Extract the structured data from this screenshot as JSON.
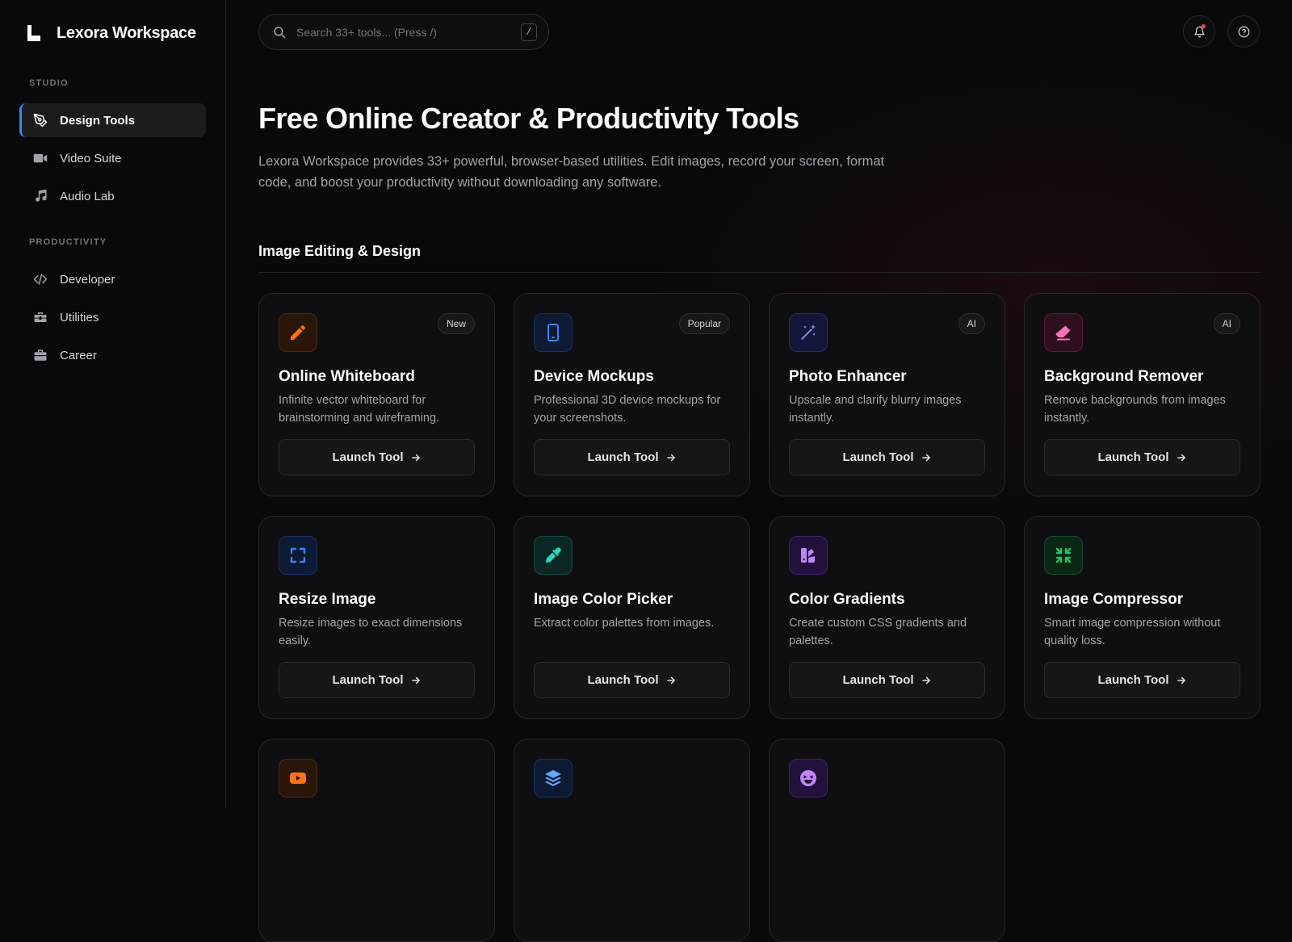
{
  "brand": {
    "name": "Lexora Workspace"
  },
  "sidebar": {
    "sections": [
      {
        "label": "STUDIO",
        "items": [
          {
            "label": "Design Tools",
            "icon": "pen-nib-icon"
          },
          {
            "label": "Video Suite",
            "icon": "video-camera-icon"
          },
          {
            "label": "Audio Lab",
            "icon": "music-note-icon"
          }
        ]
      },
      {
        "label": "PRODUCTIVITY",
        "items": [
          {
            "label": "Developer",
            "icon": "code-icon"
          },
          {
            "label": "Utilities",
            "icon": "toolbox-icon"
          },
          {
            "label": "Career",
            "icon": "briefcase-icon"
          }
        ]
      }
    ],
    "active_item": "Design Tools"
  },
  "search": {
    "placeholder": "Search 33+ tools... (Press /)",
    "shortcut": "/"
  },
  "header": {
    "notification_icon": "bell-icon",
    "help_icon": "question-circle-icon"
  },
  "hero": {
    "title": "Free Online Creator & Productivity Tools",
    "description": "Lexora Workspace provides 33+ powerful, browser-based utilities. Edit images, record your screen, format code, and boost your productivity without downloading any software."
  },
  "section": {
    "title": "Image Editing & Design"
  },
  "colors": {
    "accent": "#3b82f6",
    "notification_dot": "#ef4444"
  },
  "cards": [
    {
      "title": "Online Whiteboard",
      "description": "Infinite vector whiteboard for brainstorming and wireframing.",
      "badge": "New",
      "icon": "pencil-icon",
      "icon_color": "#f97316",
      "button": "Launch Tool"
    },
    {
      "title": "Device Mockups",
      "description": "Professional 3D device mockups for your screenshots.",
      "badge": "Popular",
      "icon": "mobile-device-icon",
      "icon_color": "#3b82f6",
      "button": "Launch Tool"
    },
    {
      "title": "Photo Enhancer",
      "description": "Upscale and clarify blurry images instantly.",
      "badge": "AI",
      "icon": "magic-wand-icon",
      "icon_color": "#6366f1",
      "button": "Launch Tool"
    },
    {
      "title": "Background Remover",
      "description": "Remove backgrounds from images instantly.",
      "badge": "AI",
      "icon": "eraser-icon",
      "icon_color": "#ec4899",
      "button": "Launch Tool"
    },
    {
      "title": "Resize Image",
      "description": "Resize images to exact dimensions easily.",
      "badge": "",
      "icon": "expand-icon",
      "icon_color": "#3b82f6",
      "button": "Launch Tool"
    },
    {
      "title": "Image Color Picker",
      "description": "Extract color palettes from images.",
      "badge": "",
      "icon": "eyedropper-icon",
      "icon_color": "#2dd4bf",
      "button": "Launch Tool"
    },
    {
      "title": "Color Gradients",
      "description": "Create custom CSS gradients and palettes.",
      "badge": "",
      "icon": "swatchbook-icon",
      "icon_color": "#a855f7",
      "button": "Launch Tool"
    },
    {
      "title": "Image Compressor",
      "description": "Smart image compression without quality loss.",
      "badge": "",
      "icon": "compress-icon",
      "icon_color": "#22c55e",
      "button": "Launch Tool"
    },
    {
      "title": "",
      "description": "",
      "badge": "",
      "icon": "youtube-play-icon",
      "icon_color": "#f97316",
      "button": ""
    },
    {
      "title": "",
      "description": "",
      "badge": "",
      "icon": "layers-icon",
      "icon_color": "#3b82f6",
      "button": ""
    },
    {
      "title": "",
      "description": "",
      "badge": "",
      "icon": "laughing-face-icon",
      "icon_color": "#a855f7",
      "button": ""
    }
  ]
}
